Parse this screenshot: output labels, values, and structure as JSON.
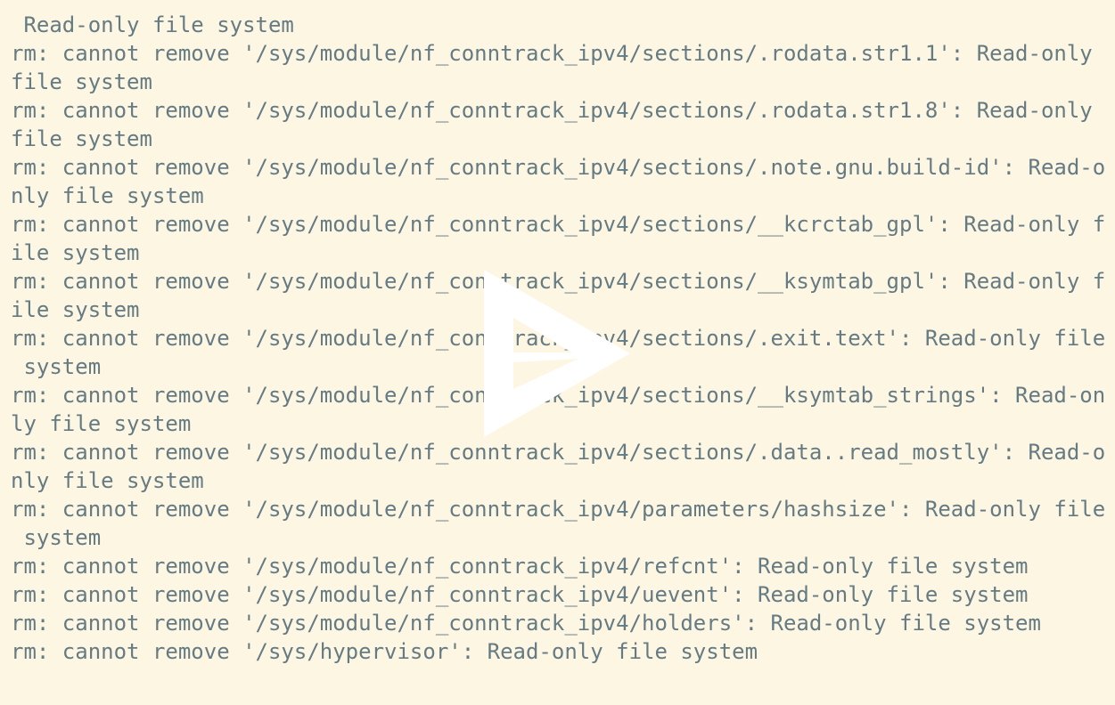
{
  "terminal": {
    "background": "#fdf6e3",
    "foreground": "#657b83",
    "lines": [
      " Read-only file system",
      "rm: cannot remove '/sys/module/nf_conntrack_ipv4/sections/.rodata.str1.1': Read-only",
      "file system",
      "rm: cannot remove '/sys/module/nf_conntrack_ipv4/sections/.rodata.str1.8': Read-only",
      "file system",
      "rm: cannot remove '/sys/module/nf_conntrack_ipv4/sections/.note.gnu.build-id': Read-o",
      "nly file system",
      "rm: cannot remove '/sys/module/nf_conntrack_ipv4/sections/__kcrctab_gpl': Read-only f",
      "ile system",
      "rm: cannot remove '/sys/module/nf_conntrack_ipv4/sections/__ksymtab_gpl': Read-only f",
      "ile system",
      "rm: cannot remove '/sys/module/nf_conntrack_ipv4/sections/.exit.text': Read-only file",
      " system",
      "rm: cannot remove '/sys/module/nf_conntrack_ipv4/sections/__ksymtab_strings': Read-on",
      "ly file system",
      "rm: cannot remove '/sys/module/nf_conntrack_ipv4/sections/.data..read_mostly': Read-o",
      "nly file system",
      "rm: cannot remove '/sys/module/nf_conntrack_ipv4/parameters/hashsize': Read-only file",
      " system",
      "rm: cannot remove '/sys/module/nf_conntrack_ipv4/refcnt': Read-only file system",
      "rm: cannot remove '/sys/module/nf_conntrack_ipv4/uevent': Read-only file system",
      "rm: cannot remove '/sys/module/nf_conntrack_ipv4/holders': Read-only file system",
      "rm: cannot remove '/sys/hypervisor': Read-only file system"
    ]
  },
  "player": {
    "play_icon": "asciinema-play-icon",
    "icon_color": "#ffffff"
  }
}
